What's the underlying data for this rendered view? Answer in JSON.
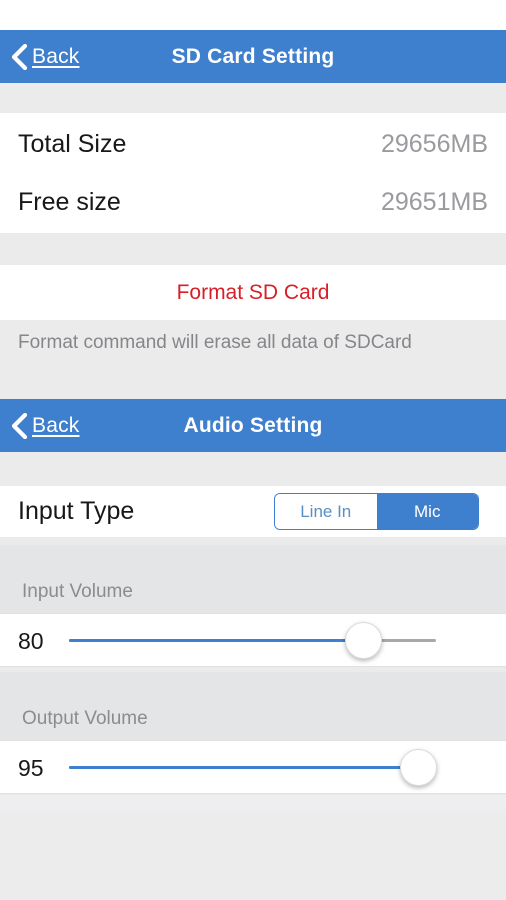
{
  "theme": {
    "accent_blue": "#3e80cd",
    "danger_red": "#d81e27",
    "value_gray": "#9a9a9f",
    "band_gray": "#e4e5e7"
  },
  "sd_card_screen": {
    "nav": {
      "back_label": "Back",
      "back_icon": "chevron-left-icon",
      "title": "SD Card Setting"
    },
    "rows": [
      {
        "label": "Total Size",
        "value": "29656MB"
      },
      {
        "label": "Free size",
        "value": "29651MB"
      }
    ],
    "format_button_label": "Format SD Card",
    "format_hint": "Format command will erase all data of SDCard"
  },
  "audio_screen": {
    "nav": {
      "back_label": "Back",
      "back_icon": "chevron-left-icon",
      "title": "Audio Setting"
    },
    "input_type": {
      "label": "Input Type",
      "options": [
        "Line In",
        "Mic"
      ],
      "option_line_in": "Line In",
      "option_mic": "Mic",
      "selected": "Mic"
    },
    "input_volume": {
      "label": "Input Volume",
      "value": "80",
      "min": 0,
      "max": 100,
      "percent": 80
    },
    "output_volume": {
      "label": "Output Volume",
      "value": "95",
      "min": 0,
      "max": 100,
      "percent": 95
    }
  }
}
